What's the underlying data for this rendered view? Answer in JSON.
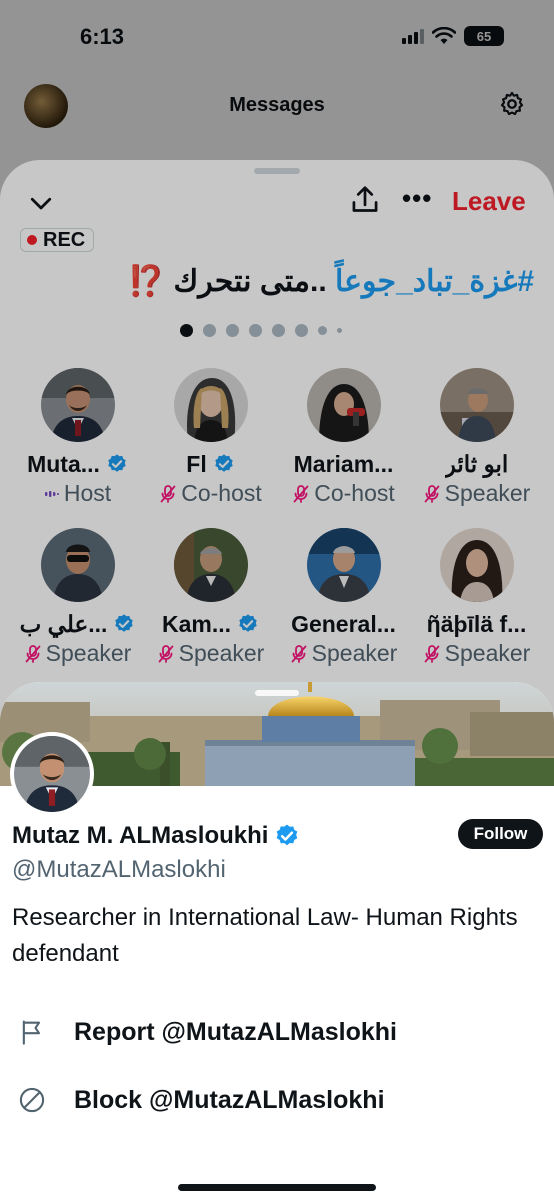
{
  "status_bar": {
    "time": "6:13",
    "battery": "65"
  },
  "messages_header": {
    "title": "Messages"
  },
  "space": {
    "leave_label": "Leave",
    "more_label": "•••",
    "rec_label": "REC",
    "title_hashtag": "#غزة_تباد_جوعاً",
    "title_text": " ..متى نتحرك ",
    "title_emoji": "⁉️",
    "page_dots": {
      "count": 7,
      "active_index": 0
    },
    "participants": [
      {
        "name": "Muta...",
        "verified": true,
        "role": "Host",
        "role_icon": "host-wave-icon"
      },
      {
        "name": "Fl",
        "verified": true,
        "role": "Co-host",
        "role_icon": "muted-mic-icon"
      },
      {
        "name": "Mariam...",
        "verified": false,
        "role": "Co-host",
        "role_icon": "muted-mic-icon"
      },
      {
        "name": "ابو ثائر",
        "verified": false,
        "role": "Speaker",
        "role_icon": "muted-mic-icon"
      },
      {
        "name": "علي ب...",
        "verified": true,
        "role": "Speaker",
        "role_icon": "muted-mic-icon"
      },
      {
        "name": "Kam...",
        "verified": true,
        "role": "Speaker",
        "role_icon": "muted-mic-icon"
      },
      {
        "name": "General...",
        "verified": false,
        "role": "Speaker",
        "role_icon": "muted-mic-icon"
      },
      {
        "name": "ῆäþīlä f...",
        "verified": false,
        "role": "Speaker",
        "role_icon": "muted-mic-icon"
      }
    ]
  },
  "profile": {
    "display_name": "Mutaz M. ALMasloukhi",
    "handle": "@MutazALMaslokhi",
    "bio": "Researcher in International Law- Human Rights defendant",
    "follow_label": "Follow",
    "actions": [
      {
        "icon": "flag-icon",
        "label": "Report @MutazALMaslokhi"
      },
      {
        "icon": "block-icon",
        "label": "Block @MutazALMaslokhi"
      }
    ]
  },
  "colors": {
    "accent": "#1d9bf0",
    "danger": "#f4212e",
    "host": "#794bc4",
    "mic_muted": "#f91880",
    "text": "#0f1419",
    "muted_text": "#536471"
  }
}
